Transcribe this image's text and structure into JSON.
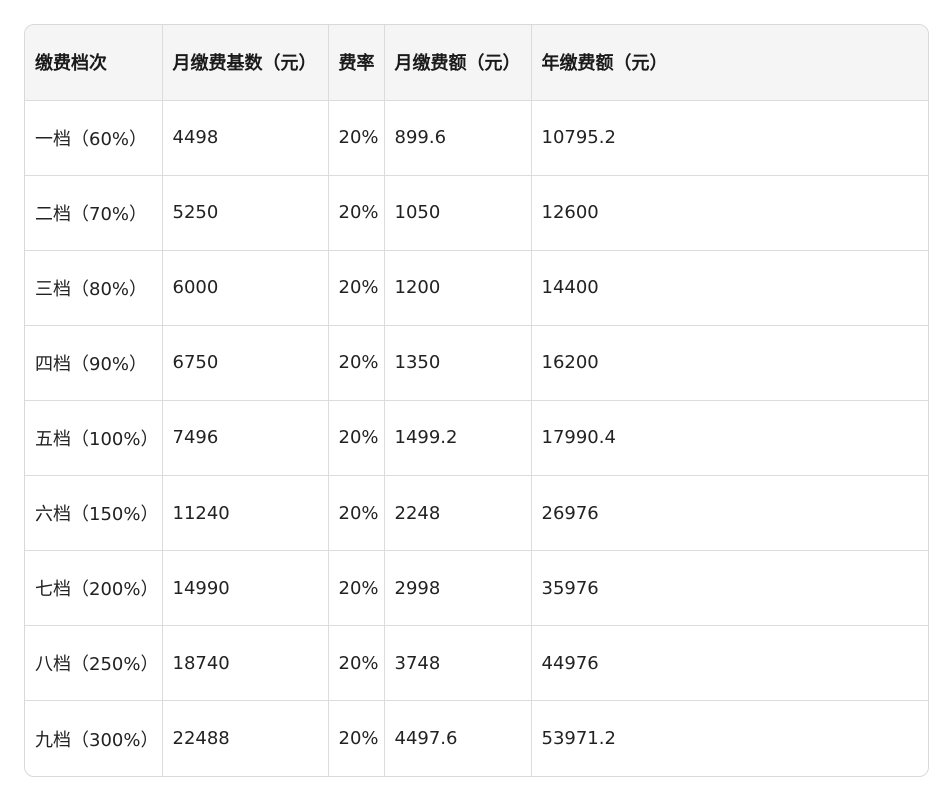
{
  "table": {
    "headers": [
      "缴费档次",
      "月缴费基数（元）",
      "费率",
      "月缴费额（元）",
      "年缴费额（元）"
    ],
    "rows": [
      [
        "一档（60%）",
        "4498",
        "20%",
        "899.6",
        "10795.2"
      ],
      [
        "二档（70%）",
        "5250",
        "20%",
        "1050",
        "12600"
      ],
      [
        "三档（80%）",
        "6000",
        "20%",
        "1200",
        "14400"
      ],
      [
        "四档（90%）",
        "6750",
        "20%",
        "1350",
        "16200"
      ],
      [
        "五档（100%）",
        "7496",
        "20%",
        "1499.2",
        "17990.4"
      ],
      [
        "六档（150%）",
        "11240",
        "20%",
        "2248",
        "26976"
      ],
      [
        "七档（200%）",
        "14990",
        "20%",
        "2998",
        "35976"
      ],
      [
        "八档（250%）",
        "18740",
        "20%",
        "3748",
        "44976"
      ],
      [
        "九档（300%）",
        "22488",
        "20%",
        "4497.6",
        "53971.2"
      ]
    ]
  }
}
